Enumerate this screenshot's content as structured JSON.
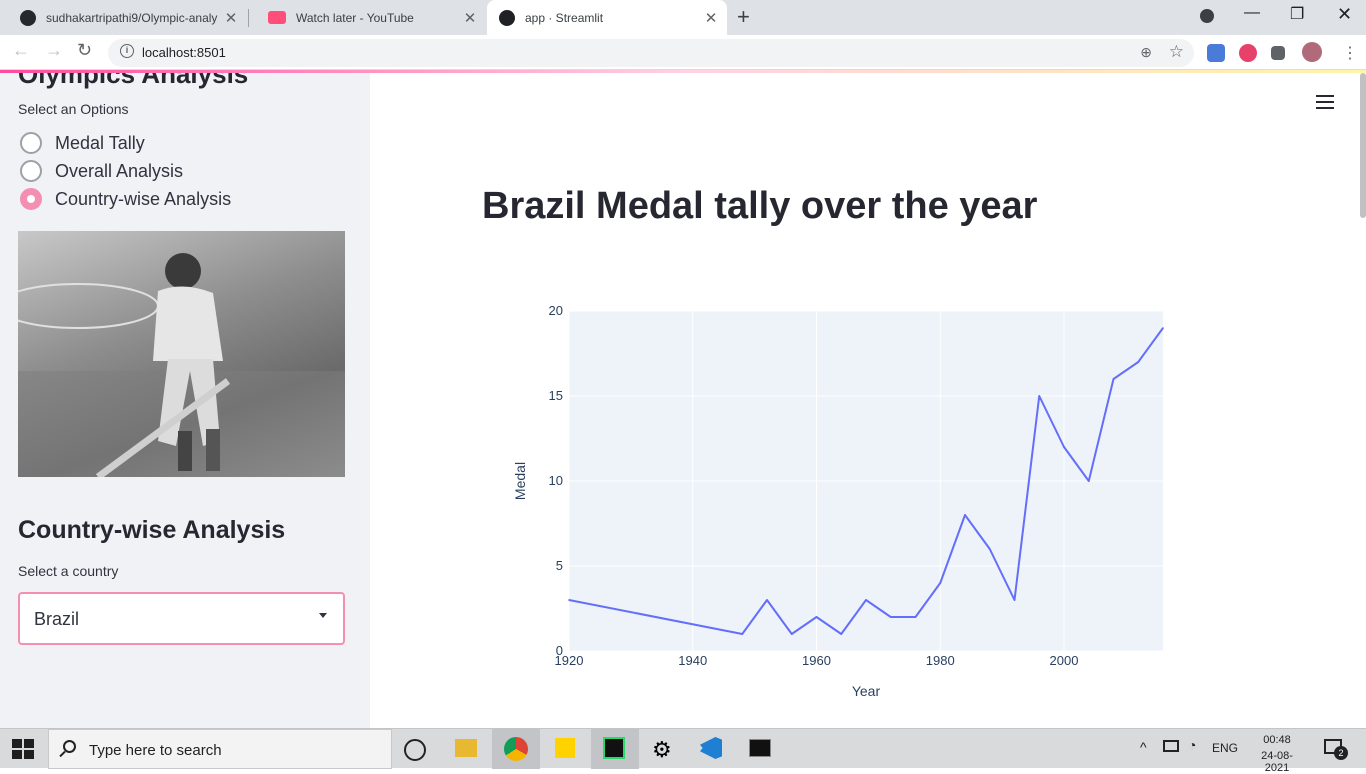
{
  "browser": {
    "tabs": [
      {
        "title": "sudhakartripathi9/Olympic-analy",
        "active": false,
        "icon": "github-icon"
      },
      {
        "title": "Watch later - YouTube",
        "active": false,
        "icon": "youtube-icon"
      },
      {
        "title": "app · Streamlit",
        "active": true,
        "icon": "streamlit-icon"
      }
    ],
    "url": "localhost:8501"
  },
  "sidebar": {
    "title": "Olympics Analysis",
    "options_label": "Select an Options",
    "options": [
      {
        "label": "Medal Tally",
        "selected": false
      },
      {
        "label": "Overall Analysis",
        "selected": false
      },
      {
        "label": "Country-wise Analysis",
        "selected": true
      }
    ],
    "section_title": "Country-wise Analysis",
    "country_label": "Select a country",
    "country_value": "Brazil"
  },
  "main": {
    "title": "Brazil Medal tally over the year"
  },
  "chart_data": {
    "type": "line",
    "xlabel": "Year",
    "ylabel": "Medal",
    "xlim": [
      1920,
      2016
    ],
    "ylim": [
      0,
      20
    ],
    "xticks": [
      1920,
      1940,
      1960,
      1980,
      2000
    ],
    "yticks": [
      0,
      5,
      10,
      15,
      20
    ],
    "grid": true,
    "line_color": "#636efa",
    "x": [
      1920,
      1948,
      1952,
      1956,
      1960,
      1964,
      1968,
      1972,
      1976,
      1980,
      1984,
      1988,
      1992,
      1996,
      2000,
      2004,
      2008,
      2012,
      2016
    ],
    "y": [
      3,
      1,
      3,
      1,
      2,
      1,
      3,
      2,
      2,
      4,
      8,
      6,
      3,
      15,
      12,
      10,
      16,
      17,
      19
    ]
  },
  "taskbar": {
    "search_placeholder": "Type here to search",
    "language": "ENG",
    "time": "00:48",
    "date": "24-08-2021",
    "notifications": "2"
  }
}
